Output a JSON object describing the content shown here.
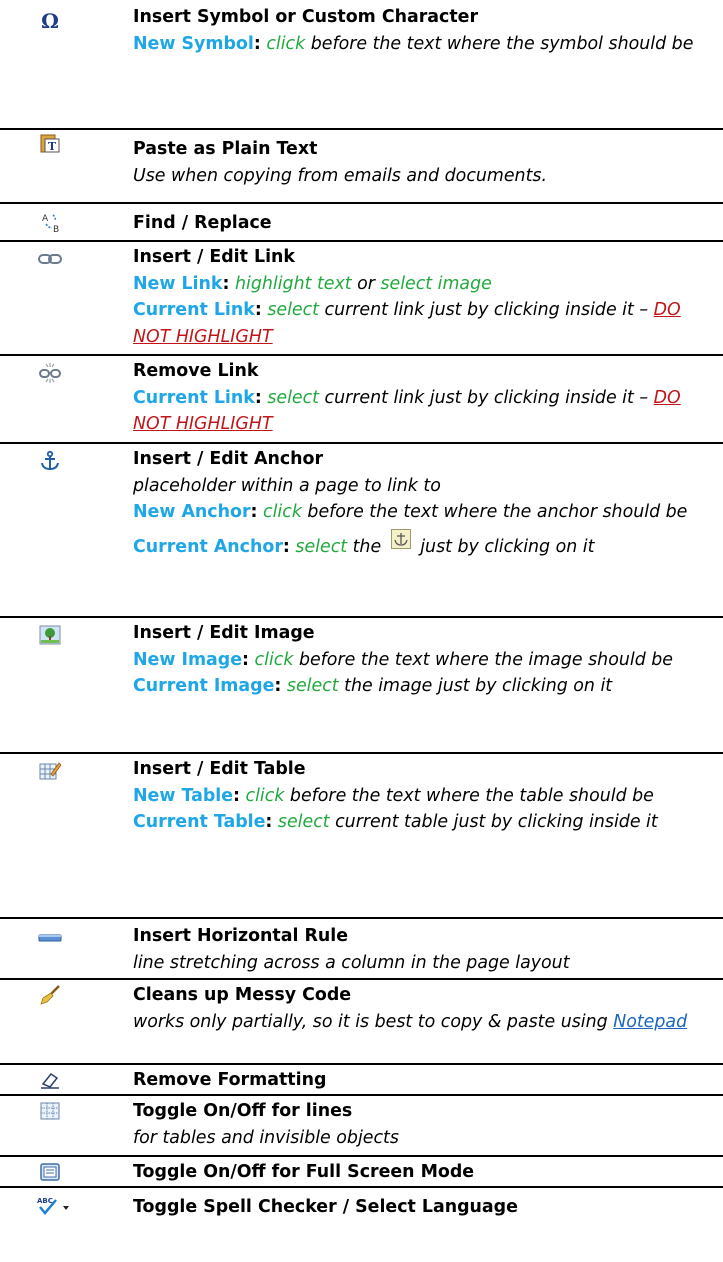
{
  "rows": [
    {
      "icon": "omega-icon",
      "title": "Insert Symbol or Custom Character",
      "new_kw": "New Symbol",
      "new_colon": ":",
      "new_act": "click",
      "new_rest": "before the text where the symbol should be"
    },
    {
      "icon": "paste-text-icon",
      "title": "Paste as Plain Text",
      "desc": "Use when copying from emails and documents."
    },
    {
      "icon": "find-replace-icon",
      "title": "Find / Replace"
    },
    {
      "icon": "link-icon",
      "title": "Insert / Edit Link",
      "new_kw": "New Link",
      "new_colon": ":",
      "new_act1": "highlight text",
      "new_or": "or",
      "new_act2": "select image",
      "cur_kw": "Current Link",
      "cur_colon": ":",
      "cur_act": "select",
      "cur_rest": "current link just by clicking inside it –",
      "cur_warn": "DO NOT HIGHLIGHT"
    },
    {
      "icon": "unlink-icon",
      "title": "Remove Link",
      "cur_kw": "Current Link",
      "cur_colon": ":",
      "cur_act": "select",
      "cur_rest": "current link just by clicking inside it –",
      "cur_warn": "DO NOT HIGHLIGHT"
    },
    {
      "icon": "anchor-icon",
      "title": "Insert / Edit Anchor",
      "desc": "placeholder within a page to link to",
      "new_kw": "New Anchor",
      "new_colon": ":",
      "new_act": "click",
      "new_rest": "before the text where the anchor should be",
      "cur_kw": "Current Anchor",
      "cur_colon": ":",
      "cur_act": "select",
      "cur_the": "the",
      "cur_rest": "just by clicking on it"
    },
    {
      "icon": "image-icon",
      "title": "Insert / Edit Image",
      "new_kw": "New Image",
      "new_colon": ":",
      "new_act": "click",
      "new_rest": "before the text where the image should be",
      "cur_kw": "Current Image",
      "cur_colon": ":",
      "cur_act": "select",
      "cur_rest": "the image just by clicking on it"
    },
    {
      "icon": "table-icon",
      "title": "Insert / Edit Table",
      "new_kw": "New Table",
      "new_colon": ":",
      "new_act": "click",
      "new_rest": "before the text where the table should be",
      "cur_kw": "Current Table",
      "cur_colon": ":",
      "cur_act": "select",
      "cur_rest": "current table just by clicking inside it"
    },
    {
      "icon": "horizontal-rule-icon",
      "title": "Insert Horizontal Rule",
      "desc": "line stretching across a column in the page layout"
    },
    {
      "icon": "broom-icon",
      "title": "Cleans up Messy Code",
      "desc": "works only partially, so it is best to copy & paste using",
      "link": "Notepad"
    },
    {
      "icon": "eraser-icon",
      "title": "Remove Formatting"
    },
    {
      "icon": "grid-lines-icon",
      "title": "Toggle On/Off for lines",
      "desc": "for tables and invisible objects"
    },
    {
      "icon": "fullscreen-icon",
      "title": "Toggle On/Off for Full Screen Mode"
    },
    {
      "icon": "spellcheck-icon",
      "title": "Toggle Spell Checker / Select Language"
    }
  ],
  "colors": {
    "keyword": "#1fa6e6",
    "action": "#21a93e",
    "warning": "#c0161a",
    "link": "#1a66c0",
    "rule": "#000000"
  }
}
